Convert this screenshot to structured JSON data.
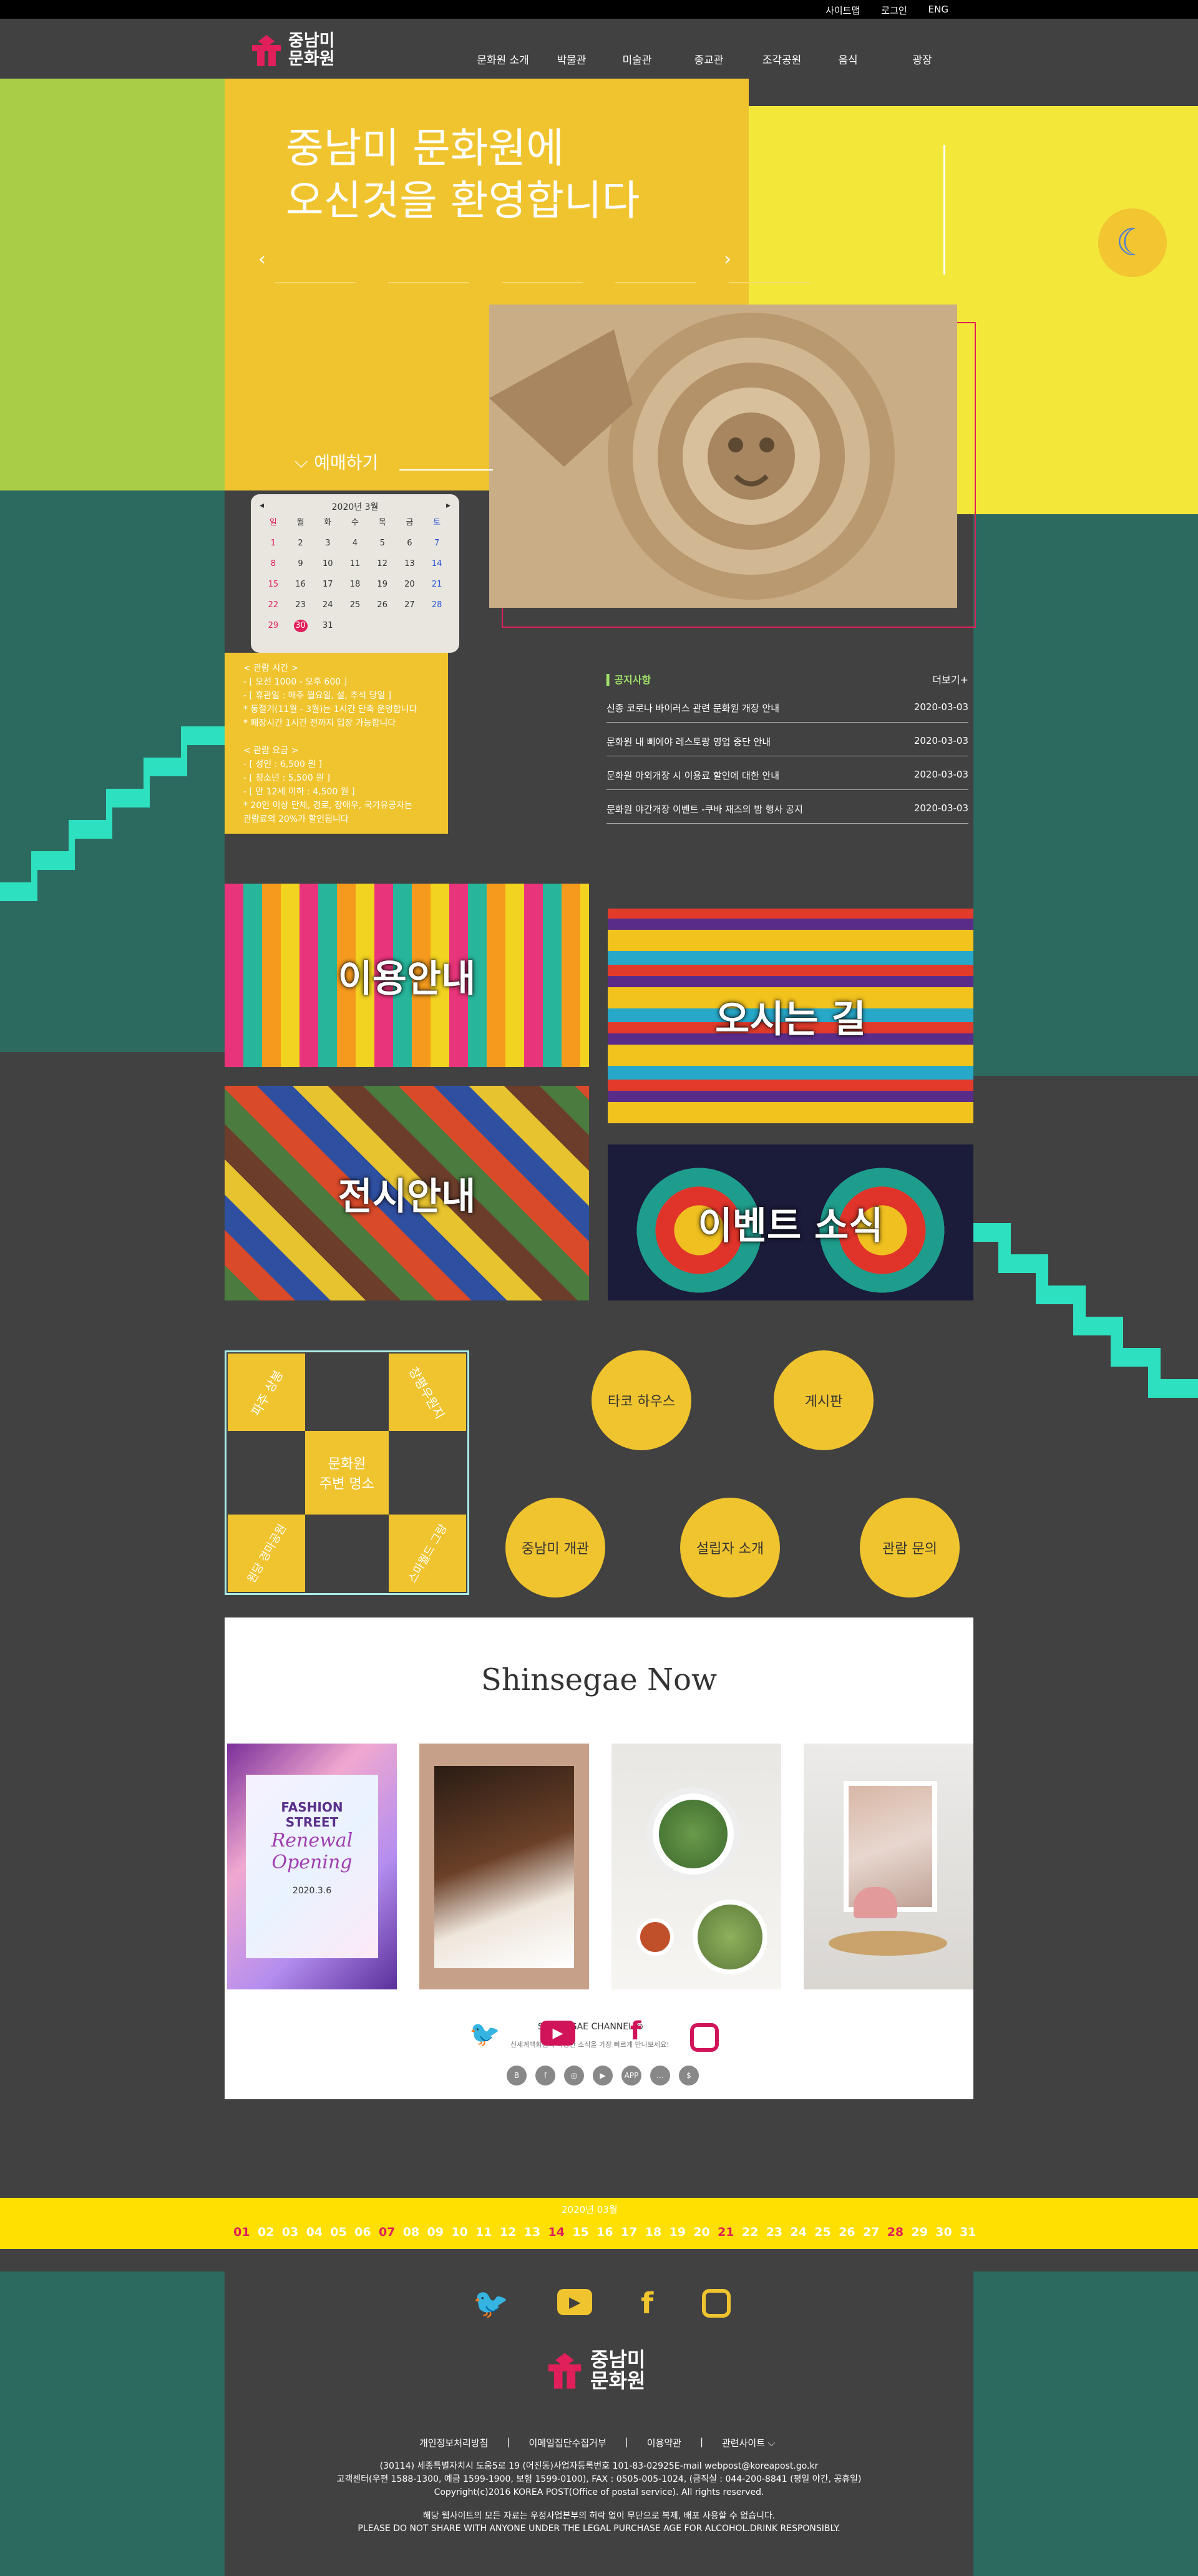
{
  "topbar": {
    "links": [
      "사이트맵",
      "로그인",
      "ENG"
    ]
  },
  "logo": {
    "line1": "중남미",
    "line2": "문화원"
  },
  "nav": {
    "items": [
      "문화원 소개",
      "박물관",
      "미술관",
      "종교관",
      "조각공원",
      "음식",
      "광장"
    ]
  },
  "hero": {
    "title": "중남미 문화원에\n오신것을 환영합니다",
    "prev": "‹",
    "next": "›",
    "reserve_label": "예매하기"
  },
  "calendar": {
    "month_label": "2020년 3월",
    "prev": "◂",
    "next": "▸",
    "weekdays": [
      "일",
      "월",
      "화",
      "수",
      "목",
      "금",
      "토"
    ],
    "days": [
      [
        "1",
        "2",
        "3",
        "4",
        "5",
        "6",
        "7"
      ],
      [
        "8",
        "9",
        "10",
        "11",
        "12",
        "13",
        "14"
      ],
      [
        "15",
        "16",
        "17",
        "18",
        "19",
        "20",
        "21"
      ],
      [
        "22",
        "23",
        "24",
        "25",
        "26",
        "27",
        "28"
      ],
      [
        "29",
        "30",
        "31",
        "",
        "",
        "",
        ""
      ]
    ]
  },
  "info": {
    "text": "< 관람 시간 >\n- [ 오전 1000 - 오후 600 ]\n- [ 휴관일 : 매주 월요일, 설, 추석 당일 ]\n* 동절기(11월 - 3월)는 1시간 단축 운영합니다\n* 폐장시간 1시간 전까지 입장 가능합니다\n\n< 관람 요금 >\n- [ 성인 : 6,500 원 ]\n- [ 청소년 : 5,500 원 ]\n- [ 만 12세 이하 : 4,500 원 ]\n* 20인 이상 단체, 경로, 장애우, 국가유공자는\n  관람료의 20%가 할인됩니다"
  },
  "notice": {
    "title": "공지사항",
    "more": "더보기+",
    "rows": [
      {
        "title": "신종 코로나 바이러스 관련 문화원 개장 안내",
        "date": "2020-03-03"
      },
      {
        "title": "문화원 내 뻬에야 레스토랑 영업 중단 안내",
        "date": "2020-03-03"
      },
      {
        "title": "문화원 아외개장 시 이용료 할인에 대한 안내",
        "date": "2020-03-03"
      },
      {
        "title": "문화원 야간개장 이벤트 -쿠바 재즈의 밤 행사 공지",
        "date": "2020-03-03"
      }
    ]
  },
  "tiles": {
    "t1": "이용안내",
    "t2": "오시는 길",
    "t3": "전시안내",
    "t4": "이벤트 소식"
  },
  "cross": {
    "center": "문화원\n주변 명소",
    "tl": "파주 상봉",
    "tr": "창평우원지",
    "bl": "원당 경마공원",
    "br": "스마월드 그랑"
  },
  "circles": {
    "c1": "타코 하우스",
    "c2": "게시판",
    "c3": "중남미 개관",
    "c4": "설립자 소개",
    "c5": "관람 문의"
  },
  "shinsegae": {
    "title": "Shinsegae Now",
    "card1_line1": "FASHION",
    "card1_line2": "STREET",
    "card1_line3": "Renewal",
    "card1_line4": "Opening",
    "card1_date": "2020.3.6",
    "channel": "SHINSEGAE CHANNEL ⊙",
    "channel_sub": "신세계백화점의 다양한 소식을 가장 빠르게 만나보세요!",
    "social": [
      "B",
      "f",
      "◎",
      "▶",
      "APP",
      "…",
      "$"
    ]
  },
  "datebar": {
    "label": "2020년 03월",
    "days": [
      "01",
      "02",
      "03",
      "04",
      "05",
      "06",
      "07",
      "08",
      "09",
      "10",
      "11",
      "12",
      "13",
      "14",
      "15",
      "16",
      "17",
      "18",
      "19",
      "20",
      "21",
      "22",
      "23",
      "24",
      "25",
      "26",
      "27",
      "28",
      "29",
      "30",
      "31"
    ]
  },
  "footer": {
    "logo1": "중남미",
    "logo2": "문화원",
    "links": [
      "개인정보처리방침",
      "|",
      "이메일집단수집거부",
      "|",
      "이용약관",
      "|",
      "관련사이트 ⌵"
    ],
    "text": "(30114) 세종특별자치시 도움5로 19 (어진동)사업자등록번호 101-83-02925E-mail webpost@koreapost.go.kr\n고객센터(우편 1588-1300, 예금 1599-1900, 보험 1599-0100), FAX : 0505-005-1024, (금직실 : 044-200-8841 (평일 야간, 공휴일)\nCopyright(c)2016 KOREA POST(Office of postal service). All rights reserved.",
    "warn": "해당 웹사이트의 모든 자료는 우정사업본부의 허락 없이 무단으로 복제, 배포 사용할 수 없습니다.\nPLEASE DO NOT SHARE WITH ANYONE UNDER THE LEGAL PURCHASE AGE FOR ALCOHOL.DRINK RESPONSIBLY."
  },
  "colors": {
    "yellow": "#f0c42f",
    "green": "#a9cd47",
    "teal": "#2c6a60",
    "mint": "#2de0c0",
    "pink": "#e11f5a",
    "dark": "#414141"
  }
}
